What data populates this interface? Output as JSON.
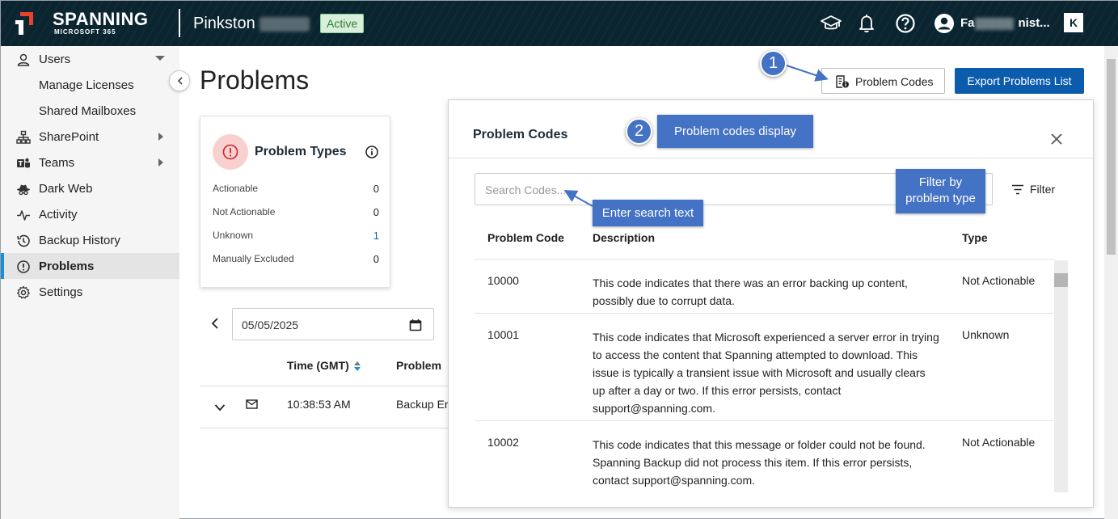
{
  "header": {
    "brand": "SPANNING",
    "brand_sub": "MICROSOFT 365",
    "tenant": "Pinkston",
    "status_badge": "Active",
    "user_name": "Fa",
    "user_name_tail": "nist...",
    "k_logo": "K"
  },
  "sidebar": {
    "items": [
      {
        "label": "Users"
      },
      {
        "label": "Manage Licenses"
      },
      {
        "label": "Shared Mailboxes"
      },
      {
        "label": "SharePoint"
      },
      {
        "label": "Teams"
      },
      {
        "label": "Dark Web"
      },
      {
        "label": "Activity"
      },
      {
        "label": "Backup History"
      },
      {
        "label": "Problems"
      },
      {
        "label": "Settings"
      }
    ]
  },
  "main": {
    "title": "Problems",
    "problem_codes_button": "Problem Codes",
    "export_button": "Export Problems List",
    "types_card": {
      "title": "Problem Types",
      "rows": [
        {
          "label": "Actionable",
          "value": "0"
        },
        {
          "label": "Not Actionable",
          "value": "0"
        },
        {
          "label": "Unknown",
          "value": "1"
        },
        {
          "label": "Manually Excluded",
          "value": "0"
        }
      ]
    },
    "date_value": "05/05/2025",
    "table": {
      "headers": [
        "Time (GMT)",
        "Problem"
      ],
      "row": {
        "time": "10:38:53 AM",
        "problem": "Backup Er"
      }
    }
  },
  "dialog": {
    "title": "Problem Codes",
    "search_placeholder": "Search Codes...",
    "filter_label": "Filter",
    "columns": [
      "Problem Code",
      "Description",
      "Type"
    ],
    "rows": [
      {
        "code": "10000",
        "description": "This code indicates that there was an error backing up content, possibly due to corrupt data.",
        "type": "Not Actionable"
      },
      {
        "code": "10001",
        "description": "This code indicates that Microsoft experienced a server error in trying to access the content that Spanning attempted to download. This issue is typically a transient issue with Microsoft and usually clears up after a day or two. If this error persists, contact support@spanning.com.",
        "type": "Unknown"
      },
      {
        "code": "10002",
        "description": "This code indicates that this message or folder could not be found. Spanning Backup did not process this item. If this error persists, contact support@spanning.com.",
        "type": "Not Actionable"
      }
    ]
  },
  "annotations": {
    "one": "1",
    "two": "2",
    "display_label": "Problem codes display",
    "search_label": "Enter search text",
    "filter_label": "Filter by problem type"
  },
  "colors": {
    "header_bg": "#0b2530",
    "primary": "#0b5cad",
    "active_nav_accent": "#1a8fd8",
    "annotation": "#4472c4",
    "badge_bg": "#d8efdc"
  }
}
